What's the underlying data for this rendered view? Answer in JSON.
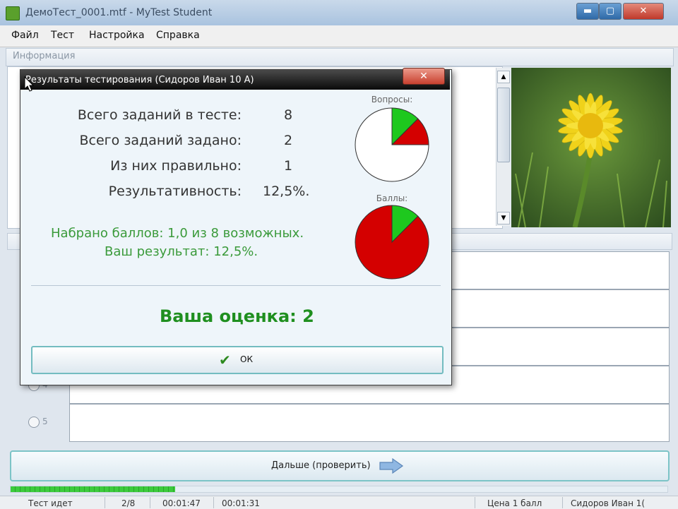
{
  "window": {
    "title": "ДемоТест_0001.mtf - MyTest Student",
    "minimize": "▬",
    "maximize": "▢",
    "close": "✕"
  },
  "menu": [
    "Файл",
    "Тест",
    "Настройка",
    "Справка"
  ],
  "info_label": "Информация",
  "answers": [
    {
      "number": "4"
    },
    {
      "number": "5"
    }
  ],
  "next_button": {
    "label": "Дальше (проверить)"
  },
  "progress": {
    "fraction": 0.25
  },
  "status": {
    "state": "Тест идет",
    "position": "2/8",
    "elapsed": "00:01:47",
    "question_time": "00:01:31",
    "price": "Цена 1 балл",
    "user": "Сидоров Иван 1("
  },
  "dialog": {
    "title": "Результаты тестирования (Сидоров Иван 10 А)",
    "close": "✕",
    "stats": [
      {
        "label": "Всего заданий в тесте:",
        "value": "8"
      },
      {
        "label": "Всего заданий задано:",
        "value": "2"
      },
      {
        "label": "Из них правильно:",
        "value": "1"
      },
      {
        "label": "Результативность:",
        "value": "12,5%."
      }
    ],
    "score_line1": "Набрано баллов: 1,0 из 8 возможных.",
    "score_line2": "Ваш результат: 12,5%.",
    "grade": "Ваша оценка: 2",
    "ok_label": "ОК",
    "pie_questions": {
      "caption": "Вопросы:",
      "slices": [
        {
          "fraction": 0.125,
          "color": "#1ec81e"
        },
        {
          "fraction": 0.125,
          "color": "#d40000"
        },
        {
          "fraction": 0.75,
          "color": "#ffffff"
        }
      ]
    },
    "pie_scores": {
      "caption": "Баллы:",
      "slices": [
        {
          "fraction": 0.125,
          "color": "#1ec81e"
        },
        {
          "fraction": 0.875,
          "color": "#d40000"
        }
      ]
    }
  },
  "icons": {
    "app": "app-icon",
    "next": "arrow-right-icon",
    "ok": "check-icon",
    "scroll_up": "triangle-up-icon",
    "scroll_down": "triangle-down-icon"
  }
}
